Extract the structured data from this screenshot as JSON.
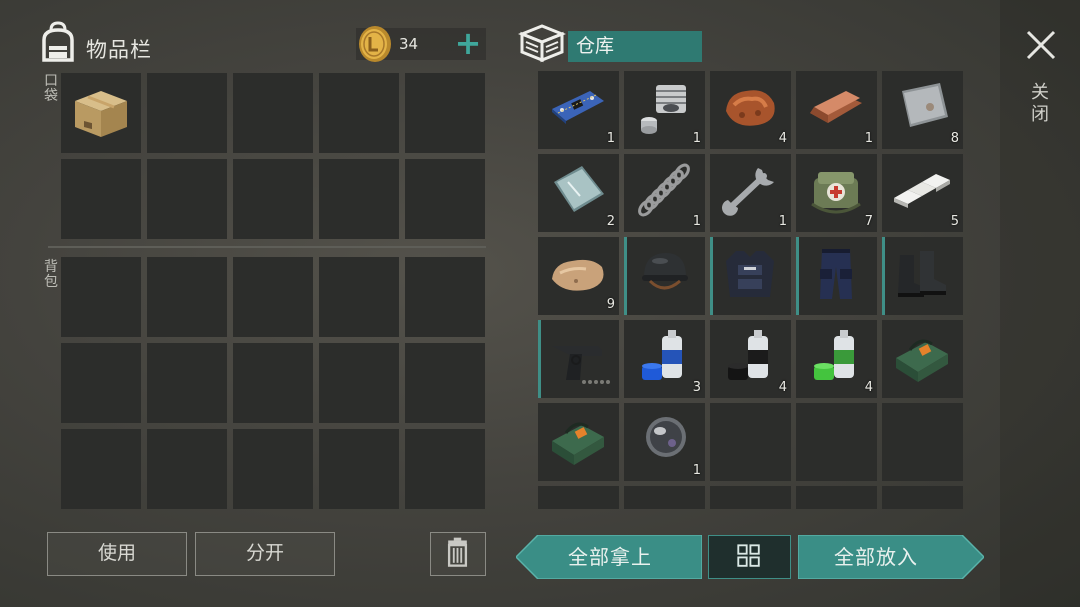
{
  "inventory": {
    "title": "物品栏",
    "coins": "34",
    "pocket_label": "口袋",
    "backpack_label": "背包"
  },
  "warehouse": {
    "title": "仓库",
    "rows": [
      [
        {
          "icon": "circuit-board-icon",
          "count": "1"
        },
        {
          "icon": "engine-parts-icon",
          "count": "1"
        },
        {
          "icon": "copper-ore-icon",
          "count": "4"
        },
        {
          "icon": "copper-ingot-icon",
          "count": "1"
        },
        {
          "icon": "iron-plate-icon",
          "count": "8"
        }
      ],
      [
        {
          "icon": "glass-sheet-icon",
          "count": "2"
        },
        {
          "icon": "spring-icon",
          "count": "1"
        },
        {
          "icon": "wrench-icon",
          "count": "1"
        },
        {
          "icon": "medkit-bag-icon",
          "count": "7"
        },
        {
          "icon": "aluminum-ingots-icon",
          "count": "5"
        }
      ],
      [
        {
          "icon": "stone-icon",
          "count": "9"
        },
        {
          "icon": "helmet-icon",
          "count": ""
        },
        {
          "icon": "body-armor-icon",
          "count": ""
        },
        {
          "icon": "armored-pants-icon",
          "count": ""
        },
        {
          "icon": "boots-icon",
          "count": ""
        }
      ],
      [
        {
          "icon": "pistol-icon",
          "count": ""
        },
        {
          "icon": "blue-spray-paint-icon",
          "count": "3"
        },
        {
          "icon": "black-spray-paint-icon",
          "count": "4"
        },
        {
          "icon": "green-spray-paint-icon",
          "count": "4"
        },
        {
          "icon": "explosive-box-icon",
          "count": ""
        }
      ],
      [
        {
          "icon": "explosive-box-icon",
          "count": ""
        },
        {
          "icon": "lens-icon",
          "count": "1"
        },
        {
          "icon": "",
          "count": ""
        },
        {
          "icon": "",
          "count": ""
        },
        {
          "icon": "",
          "count": ""
        }
      ]
    ]
  },
  "close_label": "关闭",
  "buttons": {
    "use": "使用",
    "split": "分开",
    "take_all": "全部拿上",
    "put_all": "全部放入"
  },
  "colors": {
    "accent": "#3f8f87",
    "accent_dark": "#2f7a72",
    "slot": "#2c2d2b"
  }
}
